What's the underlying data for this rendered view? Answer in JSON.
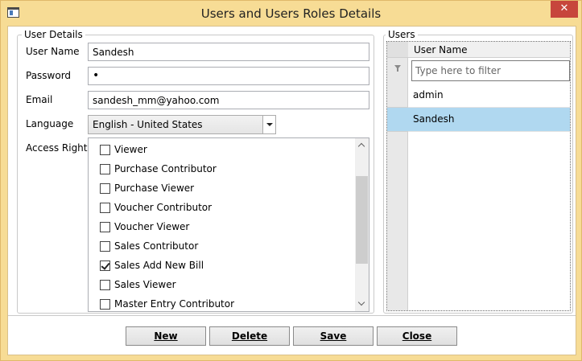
{
  "window": {
    "title": "Users and Users Roles Details",
    "close_glyph": "✕"
  },
  "user_details": {
    "legend": "User Details",
    "user_name_label": "User Name",
    "user_name_value": "Sandesh",
    "password_label": "Password",
    "password_value": "•",
    "email_label": "Email",
    "email_value": "sandesh_mm@yahoo.com",
    "language_label": "Language",
    "language_value": "English - United States",
    "access_rights_label": "Access Rights",
    "access_rights": [
      {
        "label": "Viewer",
        "checked": false
      },
      {
        "label": "Purchase Contributor",
        "checked": false
      },
      {
        "label": "Purchase Viewer",
        "checked": false
      },
      {
        "label": "Voucher Contributor",
        "checked": false
      },
      {
        "label": "Voucher Viewer",
        "checked": false
      },
      {
        "label": "Sales Contributor",
        "checked": false
      },
      {
        "label": "Sales Add New Bill",
        "checked": true
      },
      {
        "label": "Sales Viewer",
        "checked": false
      },
      {
        "label": "Master Entry Contributor",
        "checked": false
      }
    ]
  },
  "users": {
    "legend": "Users",
    "column_header": "User Name",
    "filter_placeholder": "Type here to filter",
    "rows": [
      {
        "name": "admin",
        "selected": false
      },
      {
        "name": "Sandesh",
        "selected": true
      }
    ]
  },
  "buttons": {
    "new": "New",
    "delete": "Delete",
    "save": "Save",
    "close": "Close"
  },
  "colors": {
    "title_bar": "#f7dc95",
    "close_button": "#c7463c",
    "selection": "#b0d8f0"
  }
}
